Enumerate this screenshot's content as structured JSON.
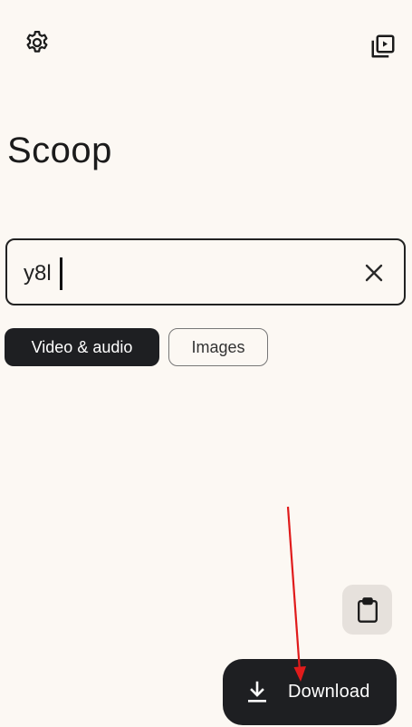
{
  "header": {
    "settings_icon": "gear-icon",
    "library_icon": "video-library-icon"
  },
  "title": "Scoop",
  "search": {
    "value": "y8l",
    "clear_icon": "close-icon"
  },
  "filters": [
    {
      "label": "Video & audio",
      "selected": true
    },
    {
      "label": "Images",
      "selected": false
    }
  ],
  "actions": {
    "paste_icon": "clipboard-icon",
    "download_label": "Download",
    "download_icon": "download-icon"
  },
  "colors": {
    "background": "#fcf8f3",
    "accent_dark": "#1e1f22",
    "annotation_arrow": "#e01b1b"
  }
}
